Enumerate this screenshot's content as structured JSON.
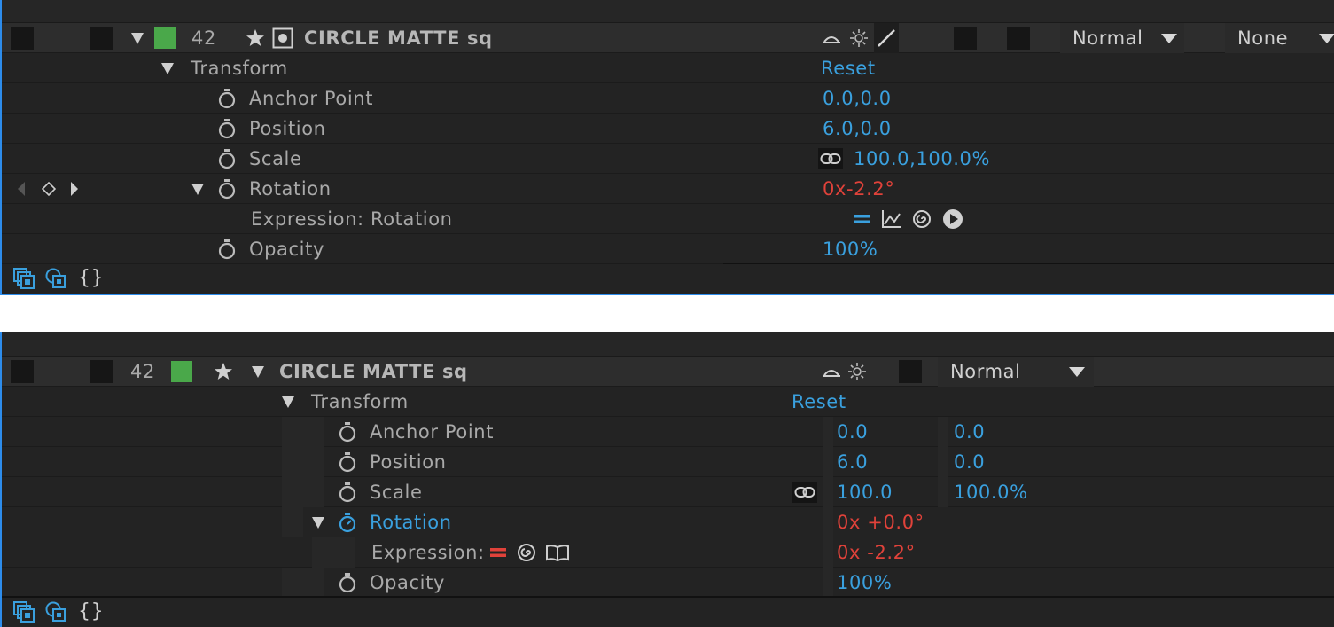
{
  "panel_top": {
    "layer": {
      "number": "42",
      "name": "CIRCLE MATTE sq",
      "color": "#4aa84a",
      "mode": "Normal",
      "parent": "None"
    },
    "transform": {
      "label": "Transform",
      "reset": "Reset"
    },
    "properties": [
      {
        "label": "Anchor Point",
        "value": "0.0,0.0"
      },
      {
        "label": "Position",
        "value": "6.0,0.0"
      },
      {
        "label": "Scale",
        "value": "100.0,100.0%"
      },
      {
        "label": "Rotation",
        "value": "0x-2.2°"
      },
      {
        "label": "Expression: Rotation",
        "value": ""
      },
      {
        "label": "Opacity",
        "value": "100%"
      }
    ]
  },
  "panel_bottom": {
    "layer": {
      "number": "42",
      "name": "CIRCLE MATTE sq",
      "color": "#4aa84a",
      "mode": "Normal"
    },
    "transform": {
      "label": "Transform",
      "reset": "Reset"
    },
    "properties": [
      {
        "label": "Anchor Point",
        "value1": "0.0",
        "value2": "0.0"
      },
      {
        "label": "Position",
        "value1": "6.0",
        "value2": "0.0"
      },
      {
        "label": "Scale",
        "value1": "100.0",
        "value2": "100.0%"
      },
      {
        "label": "Rotation",
        "value1": "0x +0.0°"
      },
      {
        "label": "Expression:",
        "value1": "0x -2.2°"
      },
      {
        "label": "Opacity",
        "value1": "100%"
      }
    ]
  },
  "colors": {
    "accent_blue": "#3aa0de",
    "value_red": "#e0423a",
    "panel_bg": "#232323",
    "focus_border": "#2d8ceb"
  }
}
